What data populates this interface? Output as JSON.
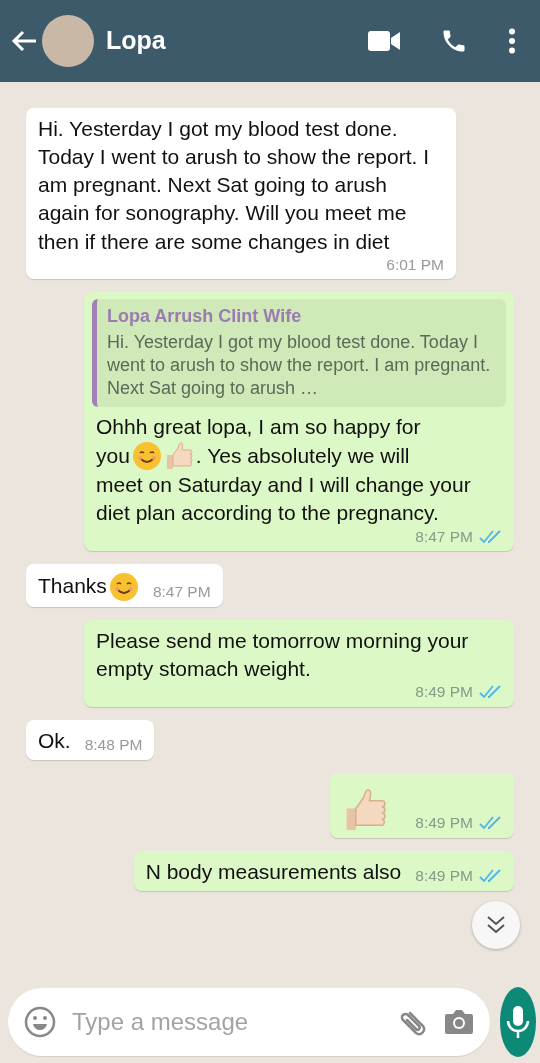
{
  "header": {
    "contact_name": "Lopa"
  },
  "messages": [
    {
      "kind": "incoming",
      "lines": [
        [
          {
            "kind": "text",
            "text": "Hi. Yesterday I got my blood test done. Today I went to arush to show the report. I am pregnant. Next Sat going to arush again for sonography. Will you meet me then if there are some changes in diet"
          }
        ]
      ],
      "time": "6:01 PM"
    },
    {
      "kind": "outgoing",
      "quote": {
        "author": "Lopa Arrush Clint Wife",
        "text": "Hi. Yesterday I got my blood test done. Today I went to arush to show the report. I am pregnant. Next Sat going to arush …"
      },
      "lines": [
        [
          {
            "kind": "text",
            "text": "Ohhh great lopa, I am so happy for"
          }
        ],
        [
          {
            "kind": "text",
            "text": "you"
          },
          {
            "kind": "smile"
          },
          {
            "kind": "thumbs"
          },
          {
            "kind": "text",
            "text": ". Yes absolutely we will"
          }
        ],
        [
          {
            "kind": "text",
            "text": "meet on Saturday and I will change your diet plan according to the pregnancy."
          }
        ]
      ],
      "time": "8:47 PM",
      "read": true
    },
    {
      "kind": "incoming",
      "lines": [
        [
          {
            "kind": "text",
            "text": "Thanks"
          },
          {
            "kind": "smile"
          }
        ]
      ],
      "time": "8:47 PM"
    },
    {
      "kind": "outgoing",
      "lines": [
        [
          {
            "kind": "text",
            "text": "Please send me tomorrow morning your empty stomach weight."
          }
        ]
      ],
      "time": "8:49 PM",
      "read": true
    },
    {
      "kind": "incoming",
      "lines": [
        [
          {
            "kind": "text",
            "text": "Ok."
          }
        ]
      ],
      "time": "8:48 PM"
    },
    {
      "kind": "outgoing",
      "lines": [
        [
          {
            "kind": "thumbs"
          }
        ]
      ],
      "time": "8:49 PM",
      "read": true
    },
    {
      "kind": "outgoing",
      "lines": [
        [
          {
            "kind": "text",
            "text": "N body measurements also"
          }
        ]
      ],
      "time": "8:49 PM",
      "read": true
    }
  ],
  "composer": {
    "placeholder": "Type a message"
  }
}
